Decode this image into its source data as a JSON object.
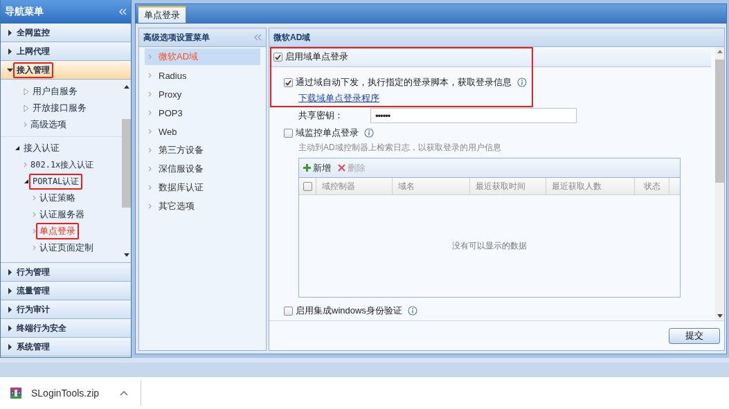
{
  "nav": {
    "title": "导航菜单",
    "sections": [
      {
        "label": "全网监控",
        "expanded": false,
        "highlighted": false
      },
      {
        "label": "上网代理",
        "expanded": false,
        "highlighted": false
      },
      {
        "label": "接入管理",
        "expanded": true,
        "highlighted": true,
        "tree_groups": [
          [
            {
              "label": "用户自服务",
              "kind": "folder",
              "expanded": false,
              "selected": false,
              "highlighted": false
            },
            {
              "label": "开放接口服务",
              "kind": "folder",
              "expanded": false,
              "selected": false,
              "highlighted": false
            },
            {
              "label": "高级选项",
              "kind": "leaf",
              "selected": false,
              "highlighted": false
            }
          ],
          [
            {
              "label": "接入认证",
              "kind": "folder",
              "expanded": true,
              "selected": false,
              "highlighted": false,
              "children": [
                {
                  "label": "802.1x接入认证",
                  "kind": "leaf",
                  "selected": false,
                  "highlighted": false
                },
                {
                  "label": "PORTAL认证",
                  "kind": "folder",
                  "expanded": true,
                  "selected": false,
                  "highlighted": true,
                  "children": [
                    {
                      "label": "认证策略",
                      "kind": "leaf",
                      "selected": false,
                      "highlighted": false
                    },
                    {
                      "label": "认证服务器",
                      "kind": "leaf",
                      "selected": false,
                      "highlighted": false
                    },
                    {
                      "label": "单点登录",
                      "kind": "leaf",
                      "selected": true,
                      "highlighted": true
                    },
                    {
                      "label": "认证页面定制",
                      "kind": "leaf",
                      "selected": false,
                      "highlighted": false
                    }
                  ]
                }
              ]
            }
          ]
        ]
      },
      {
        "label": "行为管理",
        "expanded": false,
        "highlighted": false
      },
      {
        "label": "流量管理",
        "expanded": false,
        "highlighted": false
      },
      {
        "label": "行为审计",
        "expanded": false,
        "highlighted": false
      },
      {
        "label": "终端行为安全",
        "expanded": false,
        "highlighted": false
      },
      {
        "label": "系统管理",
        "expanded": false,
        "highlighted": false
      }
    ]
  },
  "tabs": [
    {
      "label": "单点登录",
      "selected": true
    }
  ],
  "submenu": {
    "title": "高级选项设置菜单",
    "items": [
      {
        "label": "微软AD域",
        "selected": true
      },
      {
        "label": "Radius",
        "selected": false
      },
      {
        "label": "Proxy",
        "selected": false
      },
      {
        "label": "POP3",
        "selected": false
      },
      {
        "label": "Web",
        "selected": false
      },
      {
        "label": "第三方设备",
        "selected": false
      },
      {
        "label": "深信服设备",
        "selected": false
      },
      {
        "label": "数据库认证",
        "selected": false
      },
      {
        "label": "其它选项",
        "selected": false
      }
    ]
  },
  "panel": {
    "title": "微软AD域",
    "highlighted": true,
    "sso": {
      "label": "启用域单点登录",
      "checked": true
    },
    "auto_deploy": {
      "label": "通过域自动下发，执行指定的登录脚本，获取登录信息",
      "checked": true
    },
    "download_link": "下载域单点登录程序",
    "shared_key": {
      "label": "共享密钥：",
      "value": "••••••"
    },
    "monitor": {
      "label": "域监控单点登录",
      "checked": false,
      "hint": "主动到AD域控制器上检索日志，以获取登录的用户信息"
    },
    "grid": {
      "toolbar": [
        {
          "label": "新增",
          "kind": "add",
          "disabled": false
        },
        {
          "label": "删除",
          "kind": "delete",
          "disabled": true
        }
      ],
      "header_checked": false,
      "columns": [
        "域控制器",
        "域名",
        "最近获取时间",
        "最近获取人数",
        "状态"
      ],
      "empty_text": "没有可以显示的数据"
    },
    "windows_auth": {
      "label": "启用集成windows身份验证",
      "checked": false
    },
    "submit": "提交"
  },
  "download_bar": {
    "file": "SLoginTools.zip"
  }
}
